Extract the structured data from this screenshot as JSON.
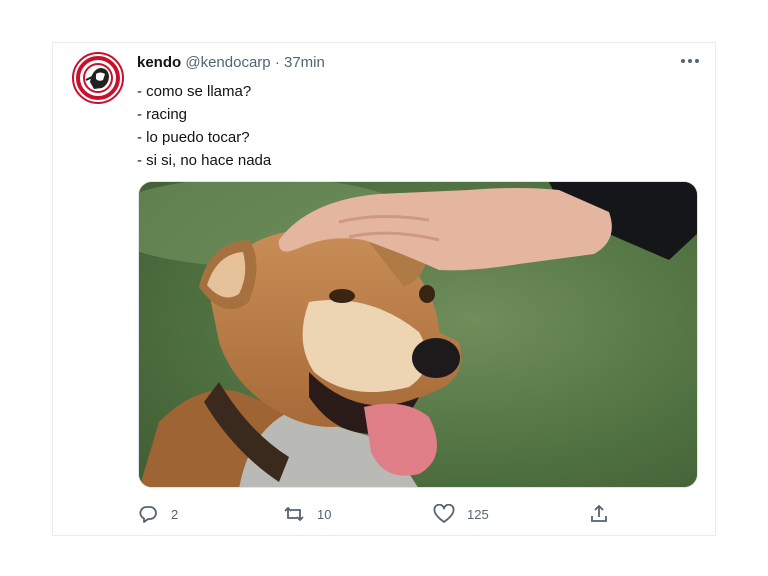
{
  "tweet": {
    "author_name": "kendo",
    "author_handle": "@kendocarp",
    "separator": "·",
    "time": "37min",
    "lines": [
      "- como se llama?",
      "- racing",
      "- lo puedo tocar?",
      "- si si, no hace nada"
    ],
    "media_icon": "dog-being-petted-photo"
  },
  "actions": {
    "reply_count": "2",
    "retweet_count": "10",
    "like_count": "125",
    "reply_icon": "reply-icon",
    "retweet_icon": "retweet-icon",
    "like_icon": "heart-icon",
    "share_icon": "share-icon"
  },
  "colors": {
    "text": "#0f1419",
    "secondary": "#536471",
    "border": "#e6ecf0",
    "avatar_red": "#c8102e"
  }
}
